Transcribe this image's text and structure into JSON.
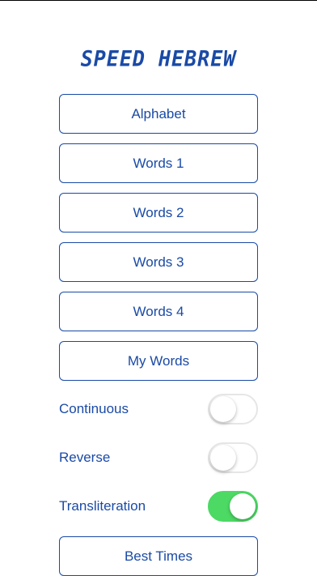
{
  "app": {
    "title": "SPEED HEBREW"
  },
  "menu": {
    "items": [
      {
        "label": "Alphabet"
      },
      {
        "label": "Words 1"
      },
      {
        "label": "Words 2"
      },
      {
        "label": "Words 3"
      },
      {
        "label": "Words 4"
      },
      {
        "label": "My Words"
      }
    ]
  },
  "settings": {
    "toggles": [
      {
        "label": "Continuous",
        "on": false
      },
      {
        "label": "Reverse",
        "on": false
      },
      {
        "label": "Transliteration",
        "on": true
      }
    ]
  },
  "bottom": {
    "best_times_label": "Best Times"
  },
  "colors": {
    "accent": "#1a4aa6",
    "toggle_on": "#4cd964",
    "toggle_off_border": "#e6e6e6"
  }
}
